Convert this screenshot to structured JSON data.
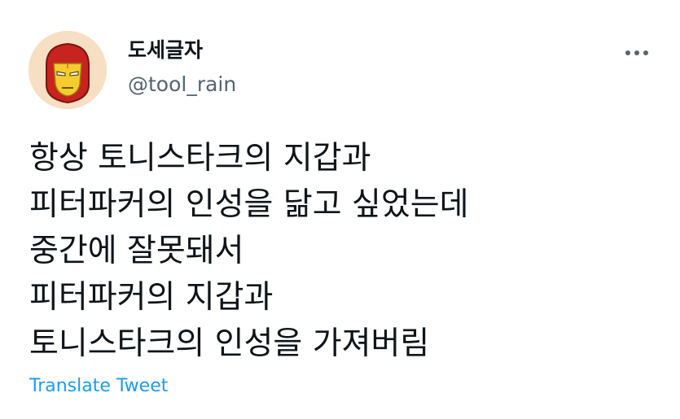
{
  "author": {
    "display_name": "도세글자",
    "handle": "@tool_rain",
    "avatar_icon": "iron-man-helmet-icon"
  },
  "more_icon": "more-options-icon",
  "tweet": {
    "lines": [
      "항상 토니스타크의 지갑과",
      "피터파커의 인성을 닮고 싶었는데",
      "중간에 잘못돼서",
      "피터파커의 지갑과",
      "토니스타크의 인성을 가져버림"
    ]
  },
  "translate_label": "Translate Tweet",
  "colors": {
    "text": "#0f1419",
    "secondary": "#536471",
    "link": "#1d9bf0",
    "avatar_background": "#f7dfc4",
    "helmet_red": "#c8231e",
    "helmet_gold": "#f5cc2e"
  }
}
